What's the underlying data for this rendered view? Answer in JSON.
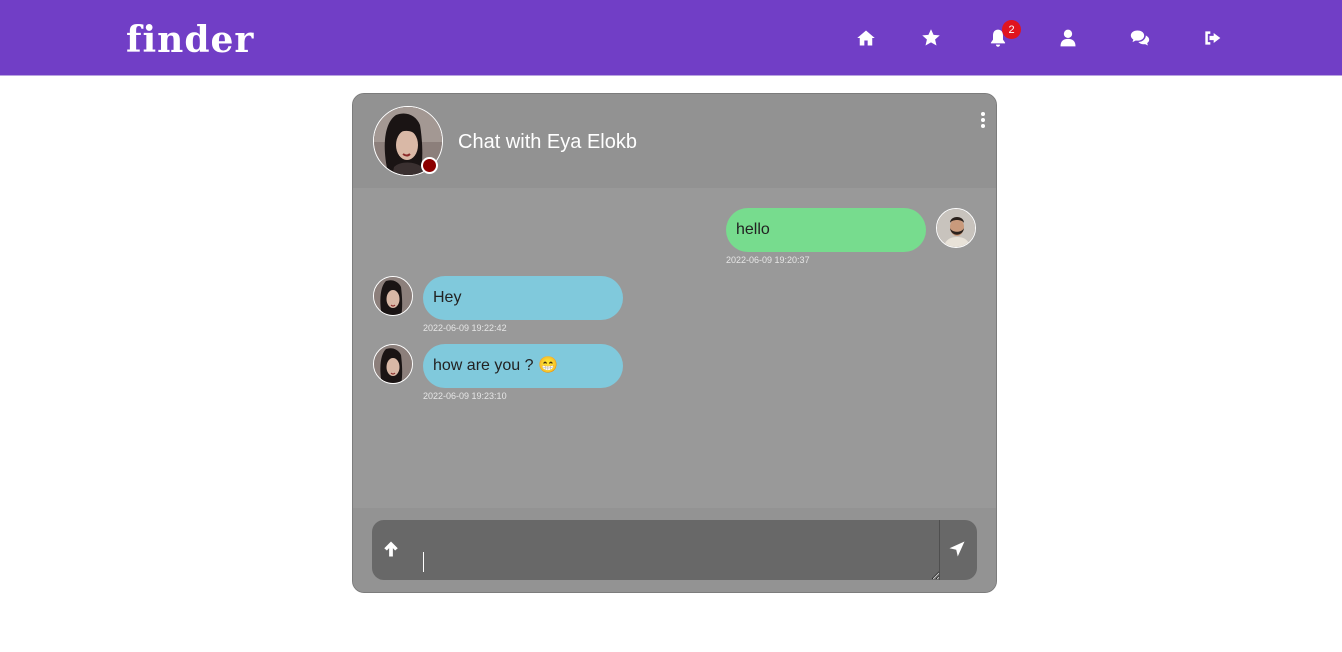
{
  "navbar": {
    "logo": "finder",
    "notification_count": "2",
    "icons": [
      "home-icon",
      "star-icon",
      "bell-icon",
      "user-icon",
      "comments-icon",
      "sign-out-icon"
    ],
    "bg_color": "#713ec6"
  },
  "chat": {
    "title": "Chat with Eya Elokb",
    "status_color": "#8b0000",
    "messages": [
      {
        "direction": "outgoing",
        "text": "hello",
        "time": "2022-06-09 19:20:37"
      },
      {
        "direction": "incoming",
        "text": "Hey",
        "time": "2022-06-09 19:22:42"
      },
      {
        "direction": "incoming",
        "text": "how are you ? 😁",
        "time": "2022-06-09 19:23:10"
      }
    ],
    "outgoing_color": "#77dc8e",
    "incoming_color": "#80c9dc"
  },
  "composer": {
    "value": "",
    "upload_icon": "arrow-up-icon",
    "send_icon": "paper-plane-icon"
  }
}
